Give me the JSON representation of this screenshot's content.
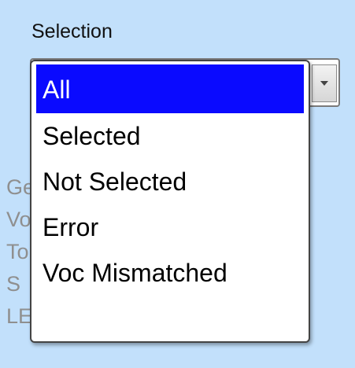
{
  "label": "Selection",
  "dropdown": {
    "selected_value": "All",
    "options": [
      "All",
      "Selected",
      "Not Selected",
      "Error",
      "Voc Mismatched"
    ]
  },
  "background_items": [
    {
      "text": "Genre",
      "index": 0
    },
    {
      "text": "Voc",
      "index": 1
    },
    {
      "text": "Tone Indicator",
      "index": 2
    },
    {
      "text": "S",
      "index": 3
    },
    {
      "text": "LE Indicator",
      "index": 4
    }
  ],
  "colors": {
    "panel_background": "#c2e0fb",
    "highlight": "#0a0aff"
  },
  "icons": {
    "dropdown_arrow": "chevron-down-icon"
  }
}
